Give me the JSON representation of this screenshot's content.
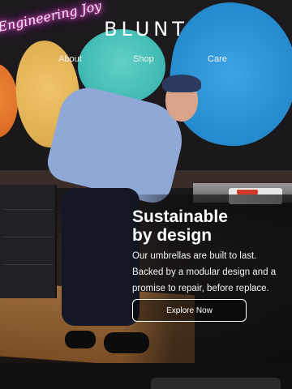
{
  "brand": {
    "logo_text": "BLUNT"
  },
  "nav": {
    "items": [
      {
        "label": "About"
      },
      {
        "label": "Shop"
      },
      {
        "label": "Care"
      }
    ]
  },
  "hero": {
    "neon_sign_text": "Engineering Joy",
    "headline_line1": "Sustainable",
    "headline_line2": "by design",
    "body": "Our umbrellas are built to last. Backed by a modular design and a promise to repair, before replace.",
    "cta_label": "Explore Now"
  }
}
